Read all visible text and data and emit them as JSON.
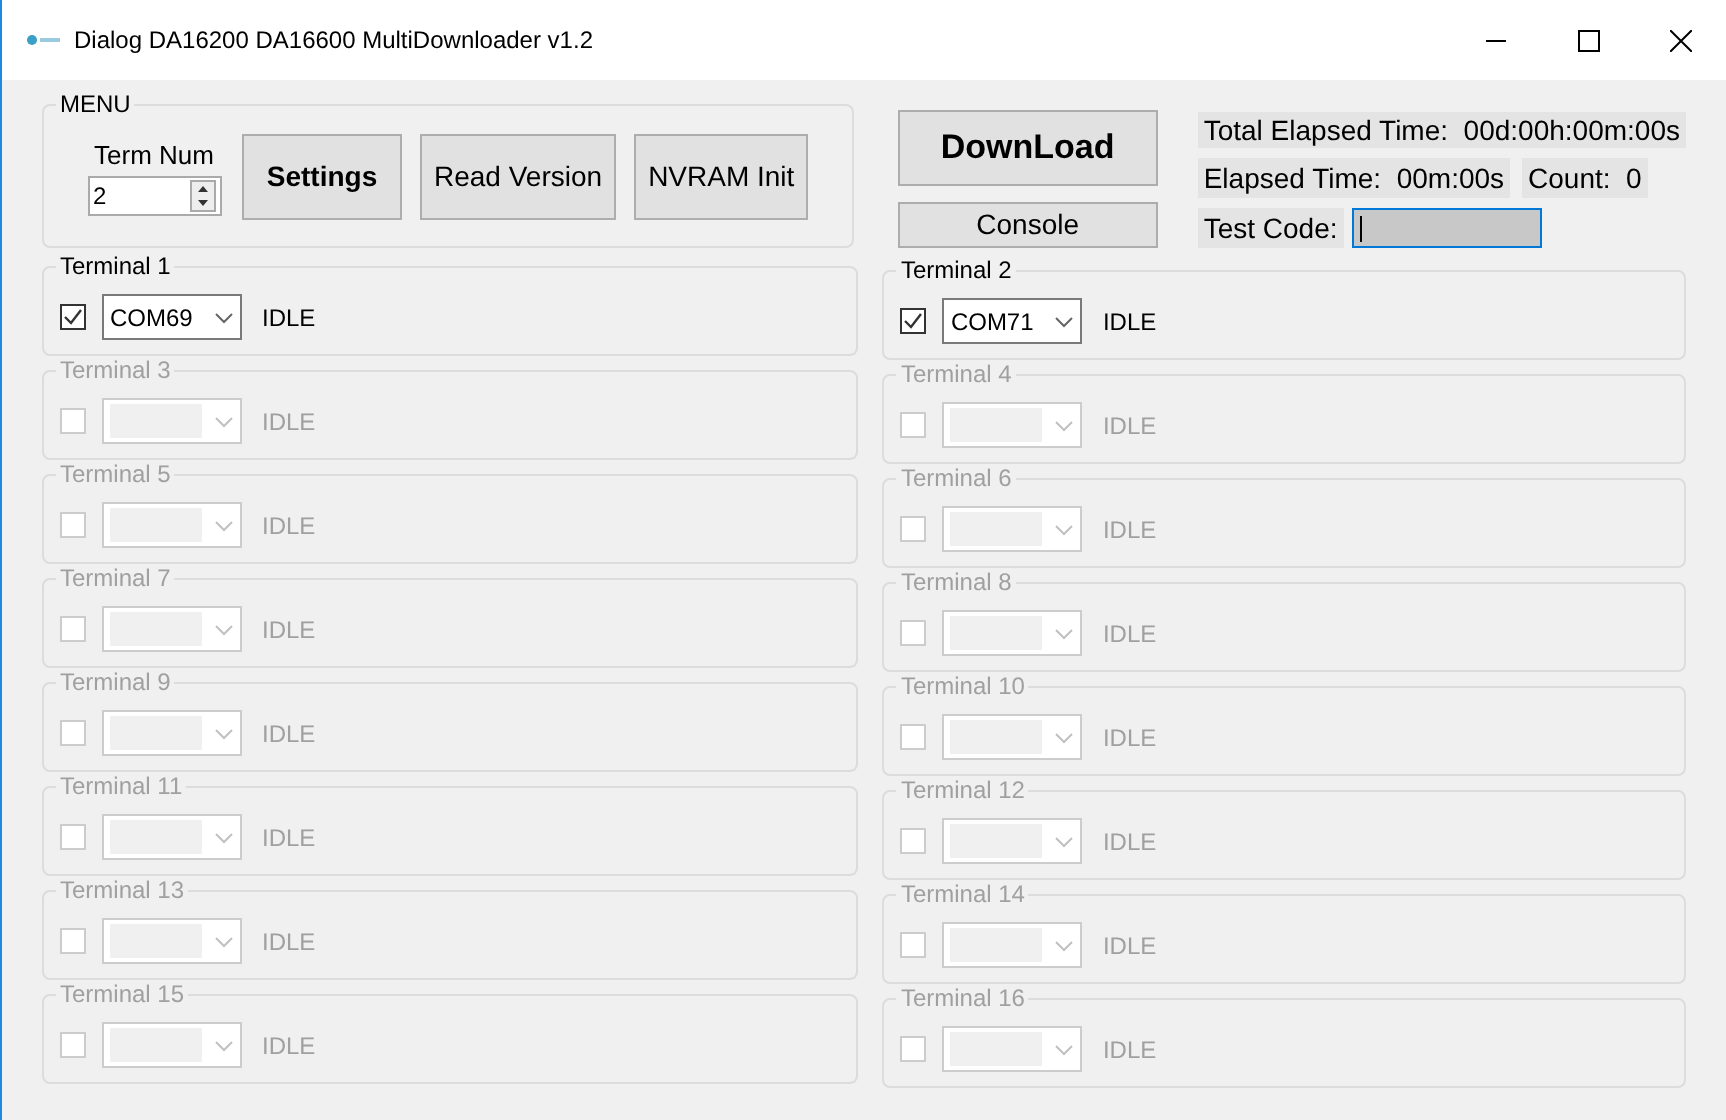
{
  "window": {
    "title": "Dialog DA16200 DA16600 MultiDownloader v1.2"
  },
  "menu": {
    "title": "MENU",
    "term_num_label": "Term Num",
    "term_num_value": "2",
    "buttons": [
      {
        "label": "Settings",
        "bold": true
      },
      {
        "label": "Read Version",
        "bold": false
      },
      {
        "label": "NVRAM Init",
        "bold": false
      }
    ]
  },
  "actions": {
    "download": "DownLoad",
    "console": "Console"
  },
  "info": {
    "total_elapsed": "Total Elapsed Time:  00d:00h:00m:00s",
    "elapsed": "Elapsed Time:  00m:00s",
    "count": "Count:  0",
    "test_code_label": "Test Code:"
  },
  "terminals": [
    {
      "label": "Terminal 1",
      "checked": true,
      "disabled": false,
      "port": "COM69",
      "status": "IDLE"
    },
    {
      "label": "Terminal 2",
      "checked": true,
      "disabled": false,
      "port": "COM71",
      "status": "IDLE"
    },
    {
      "label": "Terminal 3",
      "checked": false,
      "disabled": true,
      "status": "IDLE"
    },
    {
      "label": "Terminal 4",
      "checked": false,
      "disabled": true,
      "status": "IDLE"
    },
    {
      "label": "Terminal 5",
      "checked": false,
      "disabled": true,
      "status": "IDLE"
    },
    {
      "label": "Terminal 6",
      "checked": false,
      "disabled": true,
      "status": "IDLE"
    },
    {
      "label": "Terminal 7",
      "checked": false,
      "disabled": true,
      "status": "IDLE"
    },
    {
      "label": "Terminal 8",
      "checked": false,
      "disabled": true,
      "status": "IDLE"
    },
    {
      "label": "Terminal 9",
      "checked": false,
      "disabled": true,
      "status": "IDLE"
    },
    {
      "label": "Terminal 10",
      "checked": false,
      "disabled": true,
      "status": "IDLE"
    },
    {
      "label": "Terminal 11",
      "checked": false,
      "disabled": true,
      "status": "IDLE"
    },
    {
      "label": "Terminal 12",
      "checked": false,
      "disabled": true,
      "status": "IDLE"
    },
    {
      "label": "Terminal 13",
      "checked": false,
      "disabled": true,
      "status": "IDLE"
    },
    {
      "label": "Terminal 14",
      "checked": false,
      "disabled": true,
      "status": "IDLE"
    },
    {
      "label": "Terminal 15",
      "checked": false,
      "disabled": true,
      "status": "IDLE"
    },
    {
      "label": "Terminal 16",
      "checked": false,
      "disabled": true,
      "status": "IDLE"
    }
  ]
}
